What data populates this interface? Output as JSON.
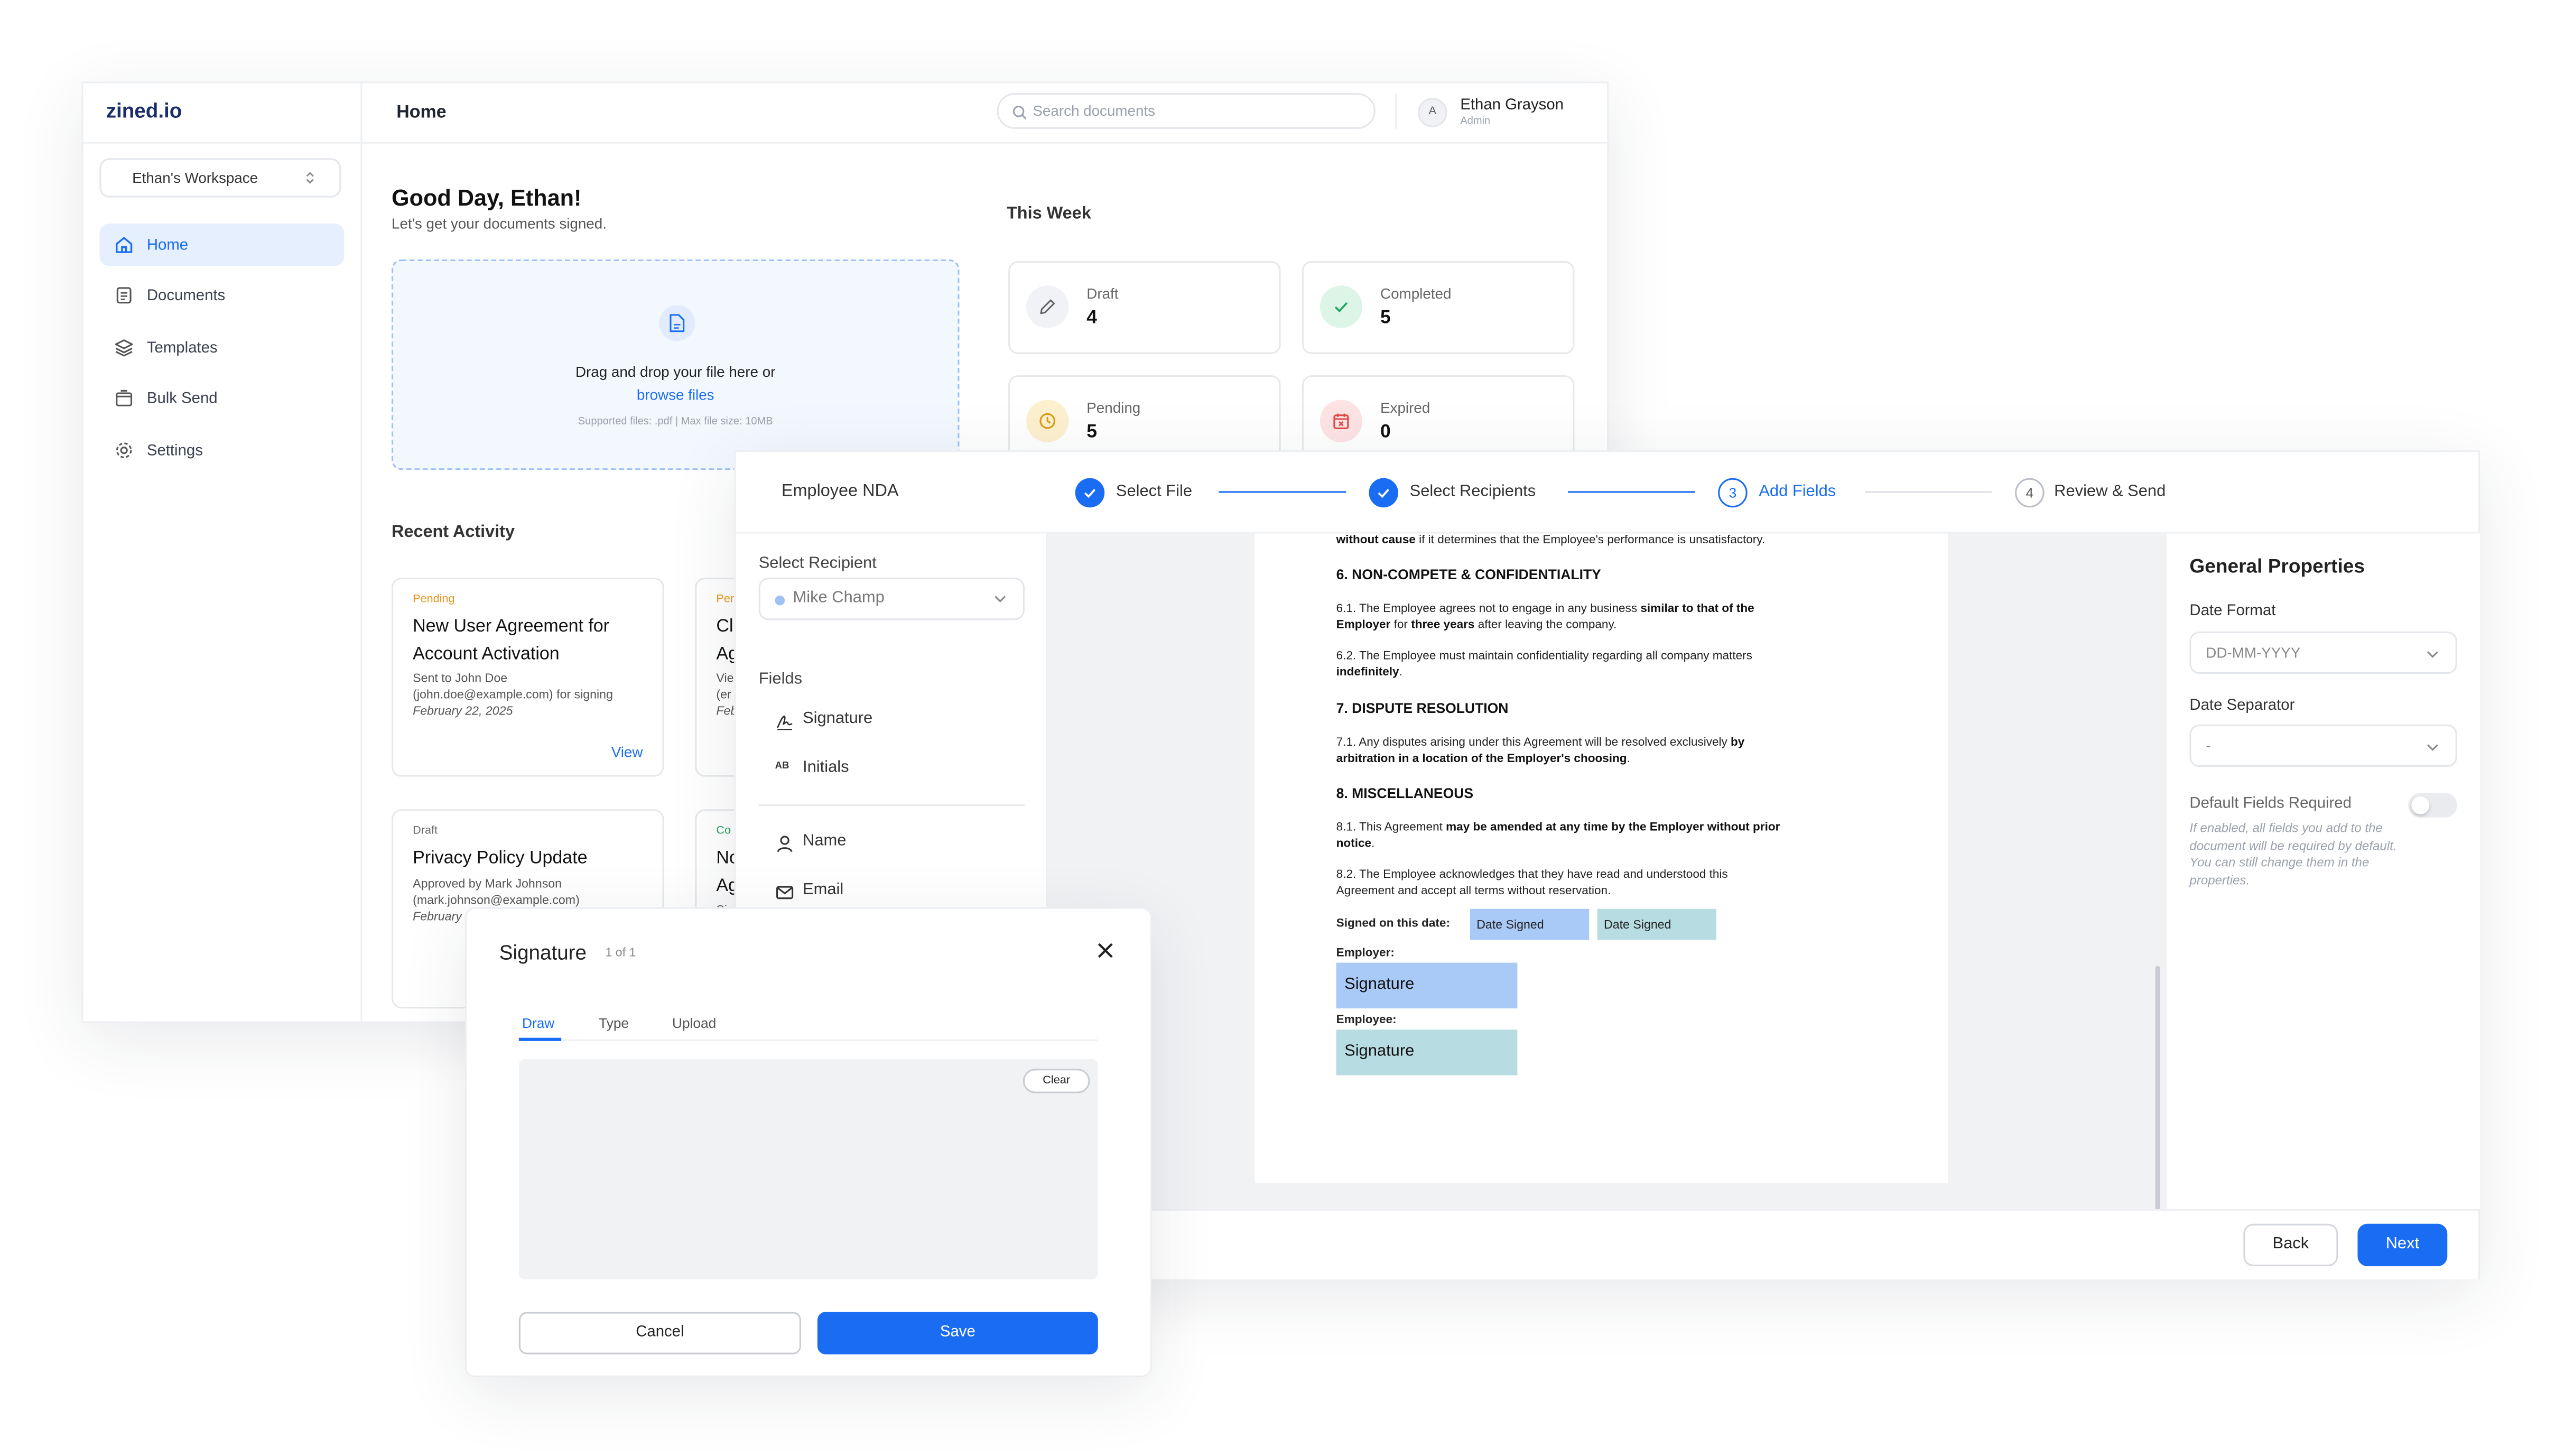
{
  "app": {
    "logo": "zined.io",
    "workspace": "Ethan's Workspace",
    "page_title": "Home",
    "search_placeholder": "Search documents",
    "user": {
      "initial": "A",
      "name": "Ethan Grayson",
      "role": "Admin"
    }
  },
  "sidebar": {
    "items": [
      {
        "label": "Home",
        "icon": "home-icon"
      },
      {
        "label": "Documents",
        "icon": "document-icon"
      },
      {
        "label": "Templates",
        "icon": "layers-icon"
      },
      {
        "label": "Bulk Send",
        "icon": "bulk-send-icon"
      },
      {
        "label": "Settings",
        "icon": "gear-icon"
      }
    ]
  },
  "home": {
    "greeting": "Good Day, Ethan!",
    "subtitle": "Let's get your documents signed.",
    "upload": {
      "text": "Drag and drop your file here or",
      "link": "browse files",
      "hint": "Supported files: .pdf | Max file size: 10MB"
    },
    "this_week_title": "This Week",
    "stats": [
      {
        "label": "Draft",
        "value": "4",
        "icon": "pencil-icon"
      },
      {
        "label": "Completed",
        "value": "5",
        "icon": "check-icon"
      },
      {
        "label": "Pending",
        "value": "5",
        "icon": "clock-icon"
      },
      {
        "label": "Expired",
        "value": "0",
        "icon": "calendar-x-icon"
      }
    ],
    "recent_title": "Recent Activity",
    "cards": [
      {
        "status": "Pending",
        "title": "New User Agreement for Account Activation",
        "desc1": "Sent to John Doe",
        "desc2": "(john.doe@example.com) for signing",
        "date": "February 22, 2025",
        "action": "View"
      },
      {
        "status": "Pen",
        "title": "Cl",
        "title2": "Ag",
        "desc1": "Vie",
        "desc2": "(er",
        "date": "Febr"
      },
      {
        "status": "Draft",
        "title": "Privacy Policy Update",
        "desc1": "Approved by Mark Johnson",
        "desc2": "(mark.johnson@example.com)",
        "date": "February"
      },
      {
        "status": "Co",
        "title": "No",
        "title2": "Ag",
        "desc1": "Sig"
      }
    ]
  },
  "wizard": {
    "document_name": "Employee NDA",
    "steps": [
      {
        "num": "1",
        "label": "Select File",
        "state": "done"
      },
      {
        "num": "2",
        "label": "Select Recipients",
        "state": "done"
      },
      {
        "num": "3",
        "label": "Add Fields",
        "state": "active"
      },
      {
        "num": "4",
        "label": "Review & Send",
        "state": "todo"
      }
    ],
    "recipient_label": "Select Recipient",
    "recipient_value": "Mike Champ",
    "fields_label": "Fields",
    "fields": [
      {
        "label": "Signature",
        "icon": "signature-icon"
      },
      {
        "label": "Initials",
        "icon": "initials-icon"
      },
      {
        "label": "Name",
        "icon": "user-icon"
      },
      {
        "label": "Email",
        "icon": "mail-icon"
      }
    ],
    "document": {
      "frag1_bold": "without cause",
      "frag1": " if it determines that the Employee's performance is unsatisfactory.",
      "h6": "6. NON-COMPETE & CONFIDENTIALITY",
      "p61a": "6.1. The Employee agrees not to engage in any business ",
      "p61b": "similar to that of the",
      "p61c": "Employer",
      "p61d": " for ",
      "p61e": "three years",
      "p61f": " after leaving the company.",
      "p62a": "6.2. The Employee must maintain confidentiality regarding all company matters",
      "p62b": "indefinitely",
      "h7": "7. DISPUTE RESOLUTION",
      "p71a": "7.1. Any disputes arising under this Agreement will be resolved exclusively ",
      "p71b": "by",
      "p71c": "arbitration in a location of the Employer's choosing",
      "h8": "8. MISCELLANEOUS",
      "p81a": "8.1. This Agreement ",
      "p81b": "may be amended at any time by the Employer without prior",
      "p81c": "notice",
      "p82a": "8.2. The Employee acknowledges that they have read and understood this",
      "p82b": "Agreement and accept all terms without reservation.",
      "signed_label": "Signed on this date:",
      "date_chip_1": "Date Signed",
      "date_chip_2": "Date Signed",
      "employer_label": "Employer:",
      "employee_label": "Employee:",
      "sig_1": "Signature",
      "sig_2": "Signature"
    },
    "properties": {
      "title": "General Properties",
      "date_format_label": "Date Format",
      "date_format_value": "DD-MM-YYYY",
      "date_sep_label": "Date Separator",
      "date_sep_value": "-",
      "default_req_label": "Default Fields Required",
      "default_req_on": false,
      "help": "If enabled, all fields you add to the document will be required by default. You can still change them in the properties."
    },
    "back": "Back",
    "next": "Next"
  },
  "signature_modal": {
    "title": "Signature",
    "counter": "1 of 1",
    "tabs": [
      "Draw",
      "Type",
      "Upload"
    ],
    "active_tab": "Draw",
    "clear": "Clear",
    "cancel": "Cancel",
    "save": "Save"
  },
  "colors": {
    "accent": "#1a6df2",
    "employer_field": "#a9c9f7",
    "employee_field": "#b7dde2"
  }
}
